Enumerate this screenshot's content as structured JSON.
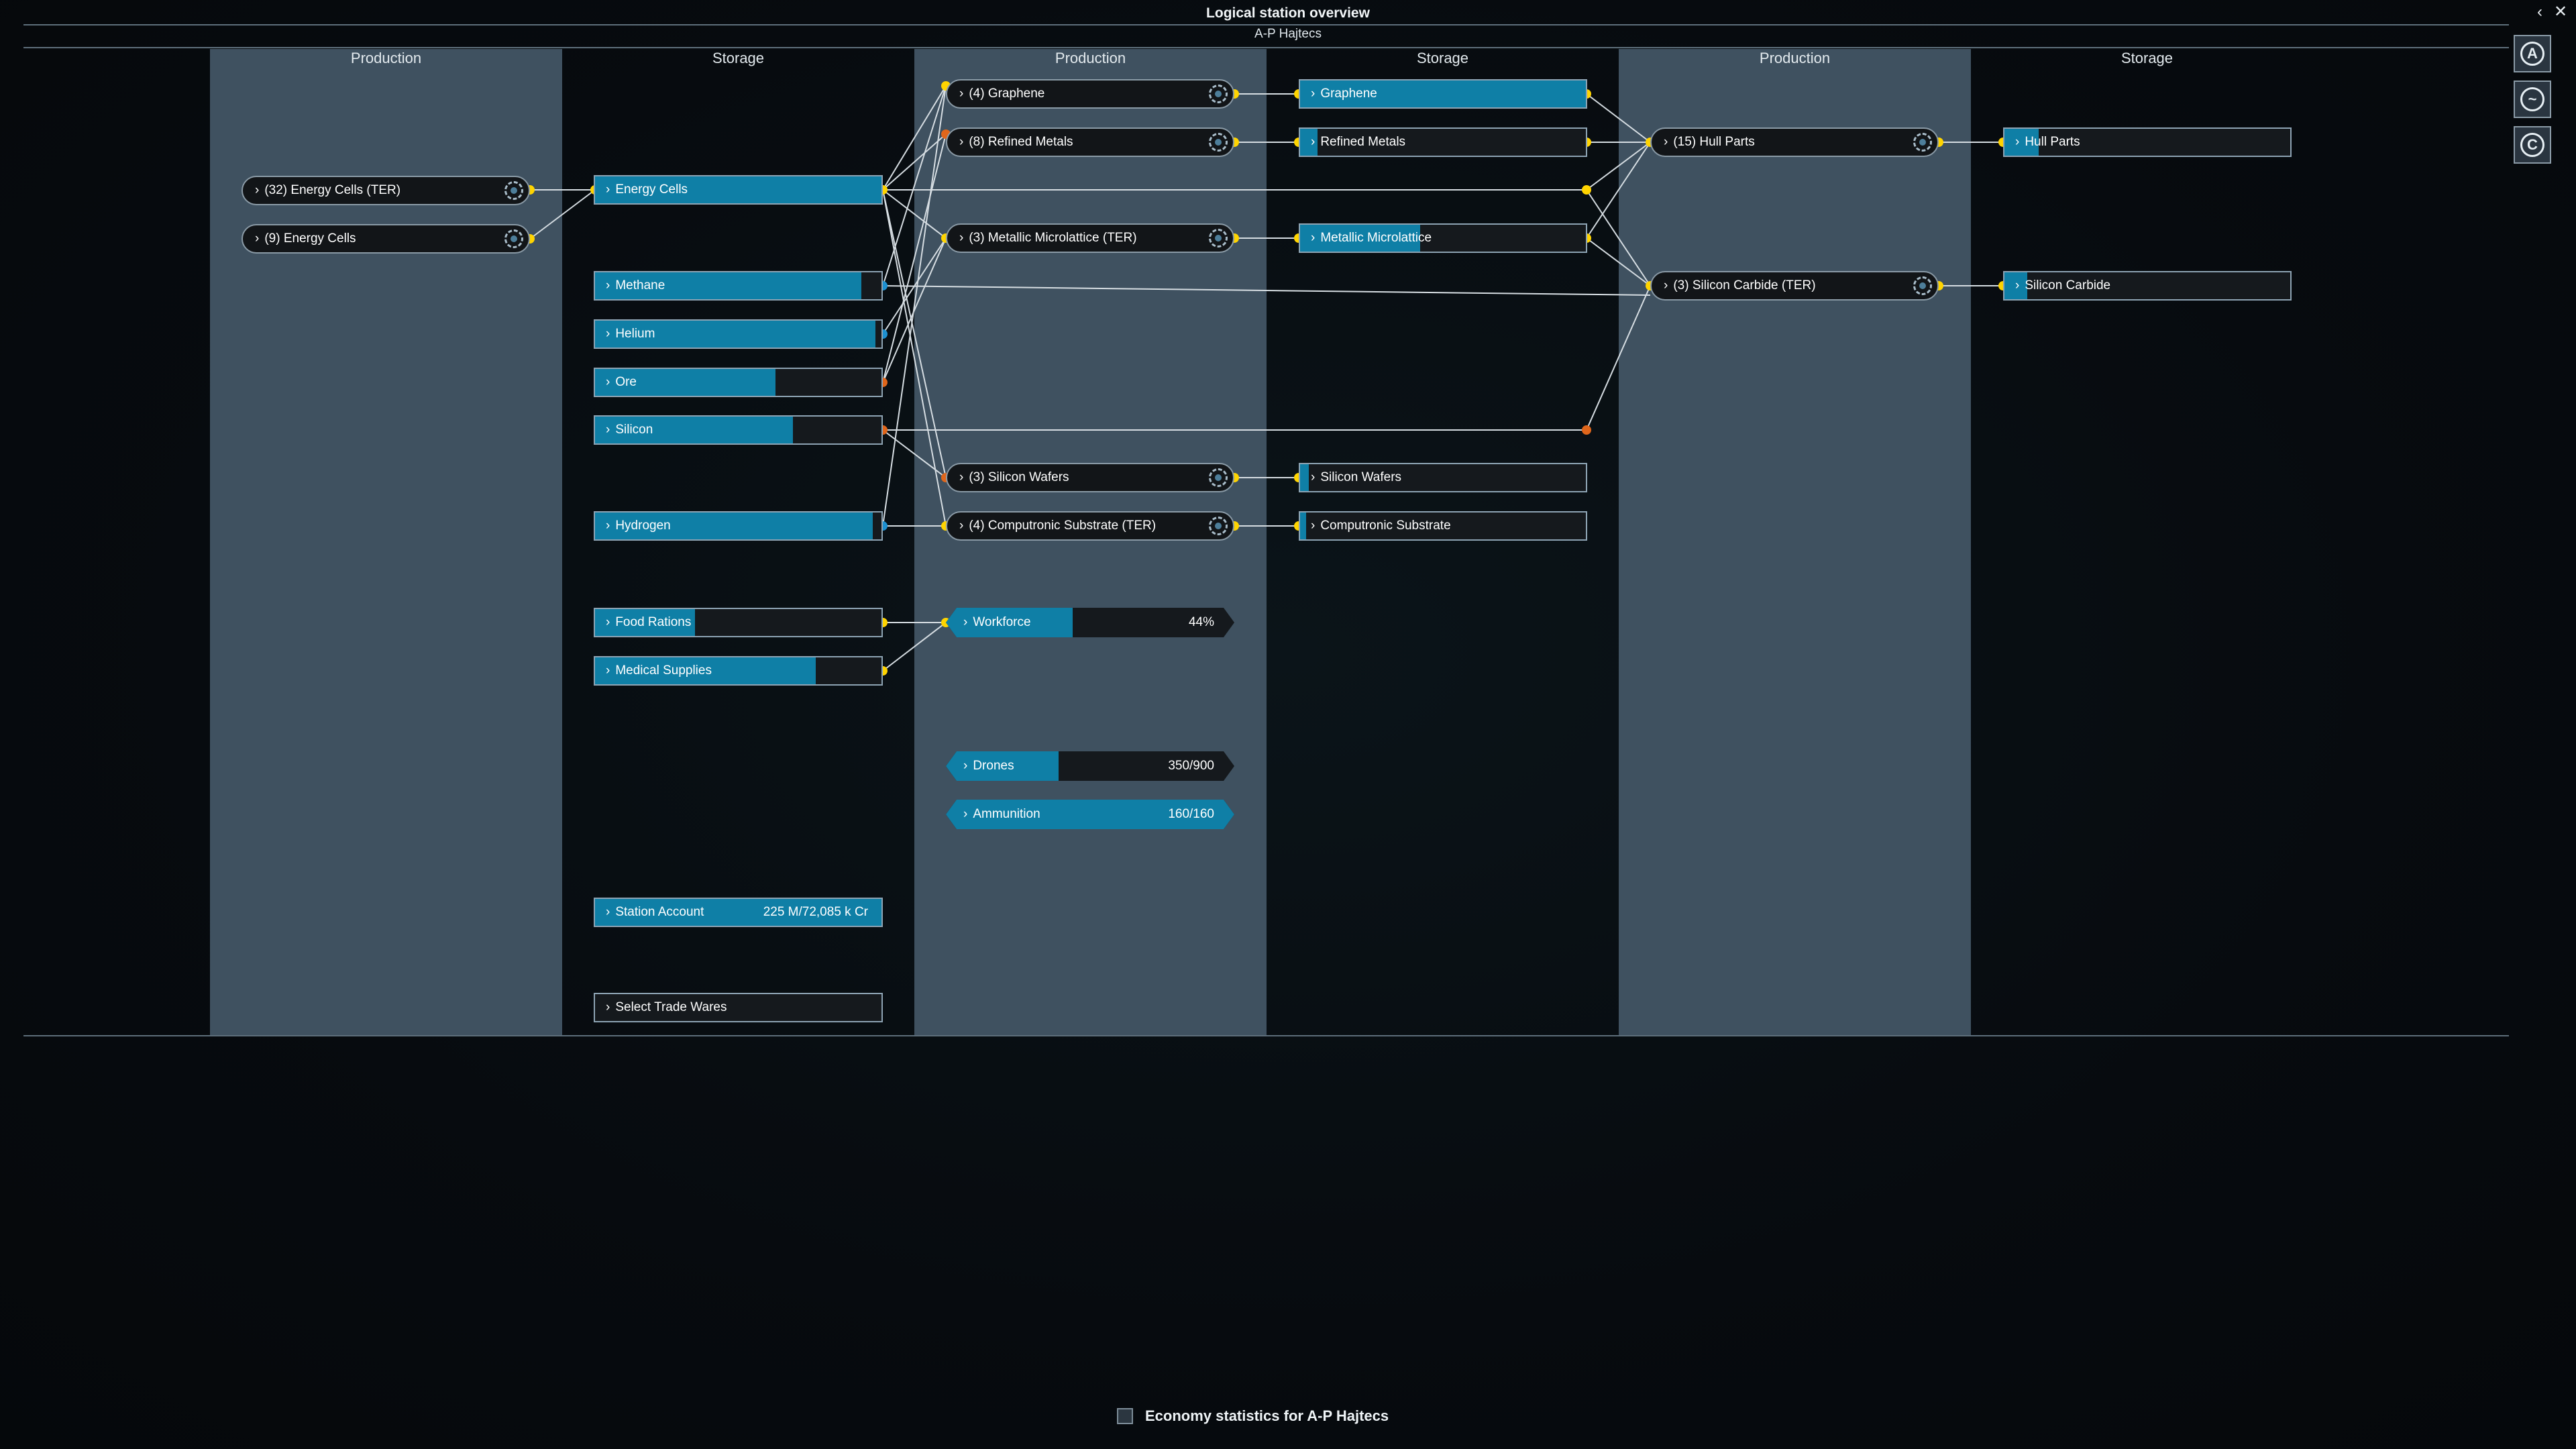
{
  "window": {
    "title": "Logical station overview",
    "station": "A-P Hajtecs",
    "back_icon": "chevron-left-icon",
    "close_icon": "close-icon"
  },
  "columns": [
    "Production",
    "Storage",
    "Production",
    "Storage",
    "Production",
    "Storage"
  ],
  "production_modules": {
    "energy_ter": "(32) Energy Cells (TER)",
    "energy": "(9) Energy Cells",
    "graphene": "(4) Graphene",
    "refined_metals": "(8) Refined Metals",
    "metallic_microlattice": "(3) Metallic Microlattice (TER)",
    "silicon_wafers": "(3) Silicon Wafers",
    "computronic_substrate": "(4) Computronic Substrate (TER)",
    "hull_parts": "(15) Hull Parts",
    "silicon_carbide": "(3) Silicon Carbide (TER)"
  },
  "storage_wares": {
    "energy_cells": {
      "label": "Energy Cells",
      "fill": 1.0
    },
    "methane": {
      "label": "Methane",
      "fill": 0.93
    },
    "helium": {
      "label": "Helium",
      "fill": 0.98
    },
    "ore": {
      "label": "Ore",
      "fill": 0.63
    },
    "silicon": {
      "label": "Silicon",
      "fill": 0.69
    },
    "hydrogen": {
      "label": "Hydrogen",
      "fill": 0.97
    },
    "food_rations": {
      "label": "Food Rations",
      "fill": 0.35
    },
    "medical_supplies": {
      "label": "Medical Supplies",
      "fill": 0.77
    },
    "graphene": {
      "label": "Graphene",
      "fill": 1.0
    },
    "refined_metals": {
      "label": "Refined Metals",
      "fill": 0.06
    },
    "metallic_microlattice": {
      "label": "Metallic Microlattice",
      "fill": 0.42
    },
    "silicon_wafers": {
      "label": "Silicon Wafers",
      "fill": 0.03
    },
    "computronic_substrate": {
      "label": "Computronic Substrate",
      "fill": 0.02
    },
    "hull_parts": {
      "label": "Hull Parts",
      "fill": 0.12
    },
    "silicon_carbide": {
      "label": "Silicon Carbide",
      "fill": 0.08
    }
  },
  "station_account": {
    "label": "Station Account",
    "value": "225 M/72,085 k Cr",
    "fill": 1.0
  },
  "select_trade_wares": "Select Trade Wares",
  "workforce": {
    "label": "Workforce",
    "value": "44%",
    "fill": 0.44
  },
  "drones": {
    "label": "Drones",
    "value": "350/900",
    "fill": 0.39
  },
  "ammunition": {
    "label": "Ammunition",
    "value": "160/160",
    "fill": 1.0
  },
  "sidebar_icons": [
    {
      "letter": "A",
      "icon": "autopilot-icon"
    },
    {
      "letter": "",
      "icon": "logical-overview-icon"
    },
    {
      "letter": "C",
      "icon": "economy-icon"
    }
  ],
  "economy_statistics": {
    "label": "Economy statistics for A-P Hajtecs",
    "checked": false
  },
  "colors": {
    "accent_fill": "#0f7fa6",
    "column_light": "#3f5160",
    "link_yellow": "#ffd400",
    "link_orange": "#e0661b",
    "link_blue": "#1e90d0"
  }
}
